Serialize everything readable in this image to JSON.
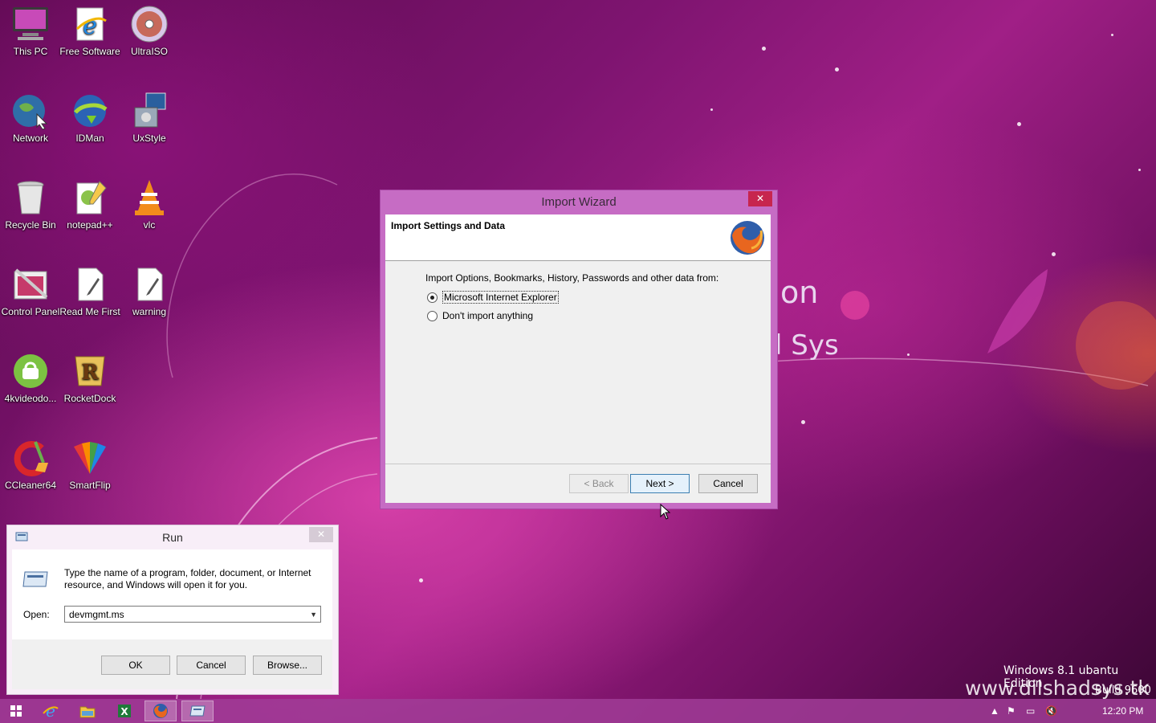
{
  "desktop": {
    "icons": [
      {
        "label": "This PC"
      },
      {
        "label": "Free Software"
      },
      {
        "label": "UltraISO"
      },
      {
        "label": "Network"
      },
      {
        "label": "IDMan"
      },
      {
        "label": "UxStyle"
      },
      {
        "label": "Recycle Bin"
      },
      {
        "label": "notepad++"
      },
      {
        "label": "vlc"
      },
      {
        "label": "Control Panel"
      },
      {
        "label": "Read Me First"
      },
      {
        "label": "warning"
      },
      {
        "label": "4kvideodo..."
      },
      {
        "label": "RocketDock"
      },
      {
        "label": "CCleaner64"
      },
      {
        "label": "SmartFlip"
      }
    ],
    "wallpaper_text": {
      "partial1": "on",
      "partial2": "l Sys",
      "edition": "Windows 8.1 ubantu Edition",
      "build": "Build 9600",
      "watermark": "www.dilshadsys.tk"
    }
  },
  "import_wizard": {
    "title": "Import Wizard",
    "close": "✕",
    "header": "Import Settings and Data",
    "prompt": "Import Options, Bookmarks, History, Passwords and other data from:",
    "options": [
      {
        "label": "Microsoft Internet Explorer",
        "selected": true
      },
      {
        "label": "Don't import anything",
        "selected": false
      }
    ],
    "back_label": "< Back",
    "next_label": "Next >",
    "cancel_label": "Cancel"
  },
  "run_dialog": {
    "title": "Run",
    "close": "✕",
    "description": "Type the name of a program, folder, document, or Internet resource, and Windows will open it for you.",
    "open_label": "Open:",
    "open_value": "devmgmt.ms",
    "ok_label": "OK",
    "cancel_label": "Cancel",
    "browse_label": "Browse..."
  },
  "taskbar": {
    "items": [
      "start-icon",
      "internet-explorer-icon",
      "file-explorer-icon",
      "excel-icon",
      "firefox-icon",
      "run-icon"
    ],
    "tray_time": "12:20 PM"
  },
  "colors": {
    "accent": "#c66cc4",
    "close_red": "#c7254e",
    "taskbar": "#a03c96"
  }
}
